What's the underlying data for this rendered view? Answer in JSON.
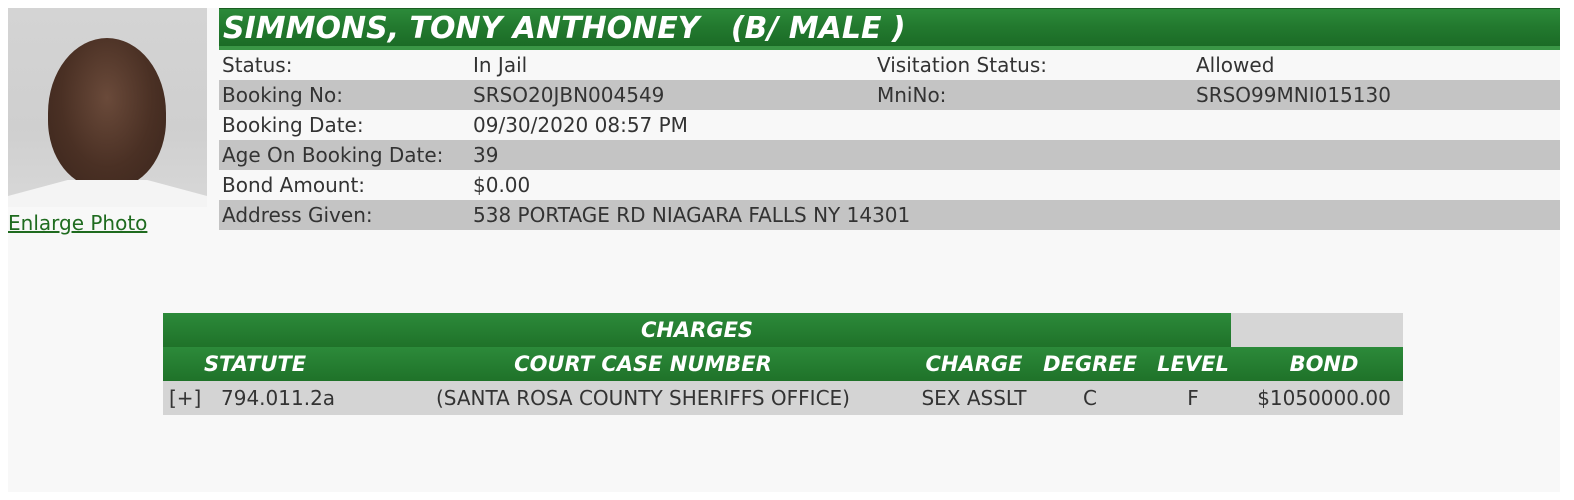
{
  "photo": {
    "enlarge_label": "Enlarge Photo"
  },
  "header": {
    "title": "SIMMONS, TONY ANTHONEY   (B/ MALE )"
  },
  "details": {
    "status_label": "Status:",
    "status_value": "In Jail",
    "visitation_label": "Visitation Status:",
    "visitation_value": "Allowed",
    "booking_no_label": "Booking No:",
    "booking_no_value": "SRSO20JBN004549",
    "mnino_label": "MniNo:",
    "mnino_value": "SRSO99MNI015130",
    "booking_date_label": "Booking Date:",
    "booking_date_value": "09/30/2020 08:57 PM",
    "age_label": "Age On Booking Date:",
    "age_value": "39",
    "bond_label": "Bond Amount:",
    "bond_value": "$0.00",
    "address_label": "Address Given:",
    "address_value": "538 PORTAGE RD NIAGARA FALLS NY 14301"
  },
  "charges": {
    "title": "CHARGES",
    "columns": {
      "statute": "STATUTE",
      "court_case": "COURT CASE NUMBER",
      "charge": "CHARGE",
      "degree": "DEGREE",
      "level": "LEVEL",
      "bond": "BOND"
    },
    "rows": [
      {
        "expand": "[+]",
        "statute": "794.011.2a",
        "court_case": "(SANTA ROSA COUNTY SHERIFFS OFFICE)",
        "charge": "SEX ASSLT",
        "degree": "C",
        "level": "F",
        "bond": "$1050000.00"
      }
    ]
  },
  "colors": {
    "header_green": "#237a2f",
    "link_green": "#1f6b1f",
    "row_alt": "#c4c4c4"
  }
}
